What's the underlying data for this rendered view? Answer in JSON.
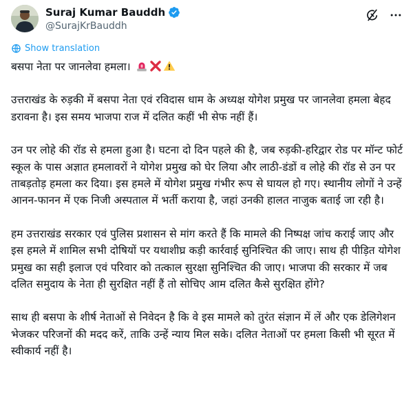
{
  "user": {
    "display_name": "Suraj Kumar Bauddh",
    "handle": "@SurajKrBauddh",
    "verified": true
  },
  "translate": {
    "label": "Show translation"
  },
  "icons": {
    "grok": "grok-icon",
    "more": "more-icon",
    "verified": "verified-badge-icon",
    "globe": "globe-icon"
  },
  "colors": {
    "accent": "#1d9bf0",
    "muted": "#536471",
    "text": "#0f1419"
  },
  "tweet": {
    "paragraphs": [
      "बसपा नेता पर जानलेवा हमला।",
      "उत्तराखंड के रुड़की में बसपा नेता एवं रविदास धाम के अध्यक्ष योगेश प्रमुख पर जानलेवा हमला बेहद डरावना है। इस समय भाजपा राज में दलित कहीं भी सेफ नहीं हैं।",
      "उन पर लोहे की रॉड से हमला हुआ है। घटना दो दिन पहले की है, जब रुड़की-हरिद्वार रोड पर मॉन्ट फोर्ट स्कूल के पास अज्ञात हमलावरों ने योगेश प्रमुख को घेर लिया और लाठी-डंडों व लोहे की रॉड से उन पर ताबड़तोड़ हमला कर दिया। इस हमले में योगेश प्रमुख गंभीर रूप से घायल हो गए। स्थानीय लोगों ने उन्हें आनन-फानन में एक निजी अस्पताल में भर्ती कराया है, जहां उनकी हालत नाजुक बताई जा रही है।",
      "हम उत्तराखंड सरकार एवं पुलिस प्रशासन से मांग करते हैं कि मामले की निष्पक्ष जांच कराई जाए और इस हमले में शामिल सभी दोषियों पर यथाशीघ्र कड़ी कार्रवाई सुनिश्चित की जाए। साथ ही पीड़ित योगेश प्रमुख का सही इलाज एवं परिवार को तत्काल सुरक्षा सुनिश्चित की जाए। भाजपा की सरकार में जब दलित समुदाय के नेता ही सुरक्षित नहीं हैं तो सोचिए आम दलित कैसे सुरक्षित होंगे?",
      "साथ ही बसपा के शीर्ष नेताओं से निवेदन है कि वे इस मामले को तुरंत संज्ञान में लें और एक डेलिगेशन भेजकर परिजनों की मदद करें, ताकि उन्हें न्याय मिल सके। दलित नेताओं पर हमला किसी भी सूरत में स्वीकार्य नहीं है।"
    ],
    "emojis": [
      "police-light-emoji",
      "cross-mark-emoji",
      "warning-emoji"
    ]
  }
}
